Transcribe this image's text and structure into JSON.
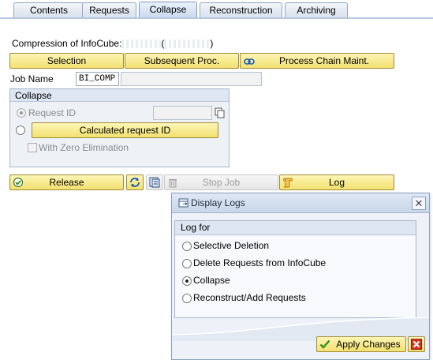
{
  "tabs": [
    {
      "label": "Contents",
      "active": false
    },
    {
      "label": "Requests",
      "active": false
    },
    {
      "label": "Collapse",
      "active": true
    },
    {
      "label": "Reconstruction",
      "active": false
    },
    {
      "label": "Archiving",
      "active": false
    }
  ],
  "compression": {
    "label": "Compression of InfoCube:",
    "name_value": "",
    "paren_open": "(",
    "paren_value": "",
    "paren_close": ")"
  },
  "toolbar": {
    "selection": "Selection",
    "subsequent": "Subsequent Proc.",
    "process_chain": "Process Chain Maint."
  },
  "job": {
    "label": "Job Name",
    "value": "BI_COMP",
    "extra_value": ""
  },
  "collapse_group": {
    "title": "Collapse",
    "request_id_label": "Request ID",
    "request_id_value": "",
    "calc_button": "Calculated request ID",
    "zero_elim_label": "With Zero Elimination",
    "selected": "request_id"
  },
  "actions": {
    "release": "Release",
    "stop_job": "Stop Job",
    "log": "Log"
  },
  "dialog": {
    "title": "Display Logs",
    "frame_title": "Log for",
    "options": [
      {
        "label": "Selective Deletion",
        "selected": false
      },
      {
        "label": "Delete Requests from InfoCube",
        "selected": false
      },
      {
        "label": "Collapse",
        "selected": true
      },
      {
        "label": "Reconstruct/Add Requests",
        "selected": false
      }
    ],
    "apply": "Apply Changes"
  },
  "colors": {
    "button_yellow": "#f2e070",
    "tab_blue": "#c7d7ee",
    "frame_blue": "#dde6f2"
  }
}
